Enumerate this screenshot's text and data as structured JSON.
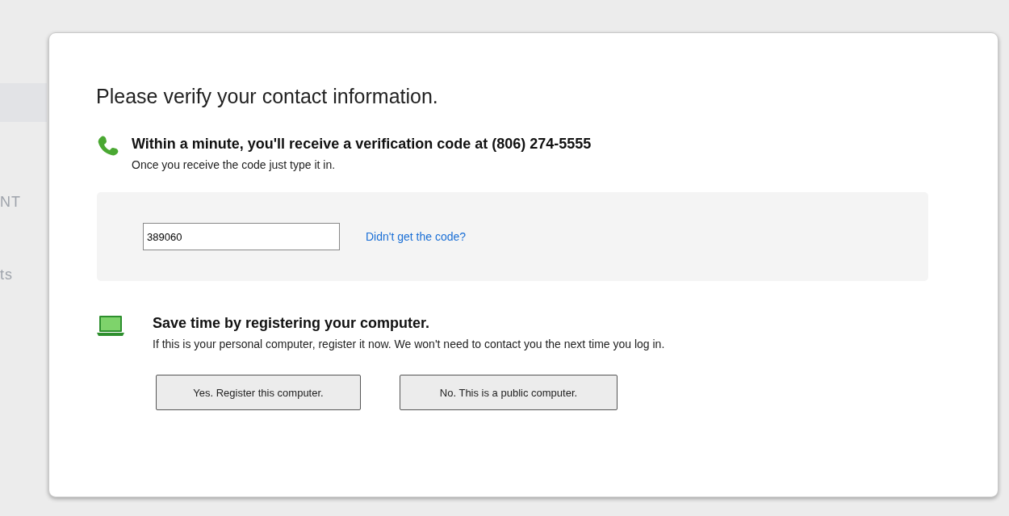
{
  "background": {
    "fragments": [
      "NT",
      "ts"
    ]
  },
  "dialog": {
    "title": "Please verify your contact information.",
    "phone_section": {
      "heading": "Within a minute, you'll receive a verification code at (806) 274-5555",
      "text": "Once you receive the code just type it in."
    },
    "code_entry": {
      "value": "389060",
      "link": "Didn't get the code?"
    },
    "computer_section": {
      "heading": "Save time by registering your computer.",
      "text": "If this is your personal computer, register it now. We won't need to contact you the next time you log in."
    },
    "buttons": [
      "Yes. Register this computer.",
      "No. This is a public computer."
    ]
  }
}
